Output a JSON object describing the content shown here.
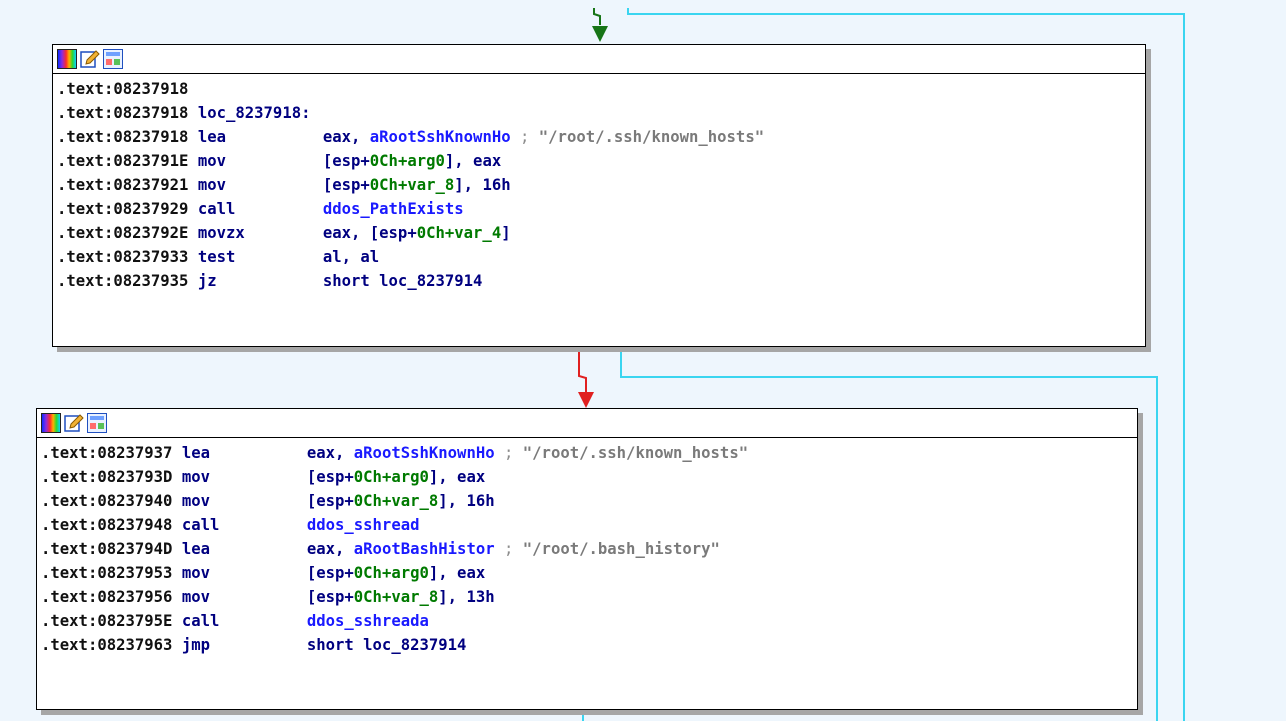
{
  "colors": {
    "background": "#eef6fd",
    "edge_false": "#3ad5f0",
    "edge_true": "#e02020",
    "edge_normal": "#177517",
    "mnemonic": "#000080",
    "symbol": "#1a1aff",
    "stack_var": "#007a00",
    "comment": "#8c8c8c"
  },
  "header_icons": [
    "color-palette-icon",
    "edit-pencil-icon",
    "graph-overview-icon"
  ],
  "block1": {
    "lines": [
      {
        "addr": ".text:08237918"
      },
      {
        "addr": ".text:08237918",
        "label": "loc_8237918:"
      },
      {
        "addr": ".text:08237918",
        "op": "lea",
        "a": "eax, ",
        "b": "aRootSshKnownHo",
        "c": "",
        "cmt": " ; ",
        "str": "\"/root/.ssh/known_hosts\""
      },
      {
        "addr": ".text:0823791E",
        "op": "mov",
        "a": "[esp+",
        "b": "0Ch+arg0",
        "c": "], eax"
      },
      {
        "addr": ".text:08237921",
        "op": "mov",
        "a": "[esp+",
        "b": "0Ch+var_8",
        "c": "], 16h"
      },
      {
        "addr": ".text:08237929",
        "op": "call",
        "a": "",
        "b": "ddos_PathExists",
        "c": ""
      },
      {
        "addr": ".text:0823792E",
        "op": "movzx",
        "a": "eax, [esp+",
        "b": "0Ch+var_4",
        "c": "]"
      },
      {
        "addr": ".text:08237933",
        "op": "test",
        "a": "al, al",
        "b": "",
        "c": ""
      },
      {
        "addr": ".text:08237935",
        "op": "jz",
        "a": "short loc_8237914",
        "b": "",
        "c": ""
      }
    ]
  },
  "block2": {
    "lines": [
      {
        "addr": ".text:08237937",
        "op": "lea",
        "a": "eax, ",
        "b": "aRootSshKnownHo",
        "c": "",
        "cmt": " ; ",
        "str": "\"/root/.ssh/known_hosts\""
      },
      {
        "addr": ".text:0823793D",
        "op": "mov",
        "a": "[esp+",
        "b": "0Ch+arg0",
        "c": "], eax"
      },
      {
        "addr": ".text:08237940",
        "op": "mov",
        "a": "[esp+",
        "b": "0Ch+var_8",
        "c": "], 16h"
      },
      {
        "addr": ".text:08237948",
        "op": "call",
        "a": "",
        "b": "ddos_sshread",
        "c": ""
      },
      {
        "addr": ".text:0823794D",
        "op": "lea",
        "a": "eax, ",
        "b": "aRootBashHistor",
        "c": "",
        "cmt": " ; ",
        "str": "\"/root/.bash_history\""
      },
      {
        "addr": ".text:08237953",
        "op": "mov",
        "a": "[esp+",
        "b": "0Ch+arg0",
        "c": "], eax"
      },
      {
        "addr": ".text:08237956",
        "op": "mov",
        "a": "[esp+",
        "b": "0Ch+var_8",
        "c": "], 13h"
      },
      {
        "addr": ".text:0823795E",
        "op": "call",
        "a": "",
        "b": "ddos_sshreada",
        "c": ""
      },
      {
        "addr": ".text:08237963",
        "op": "jmp",
        "a": "short loc_8237914",
        "b": "",
        "c": ""
      }
    ]
  }
}
